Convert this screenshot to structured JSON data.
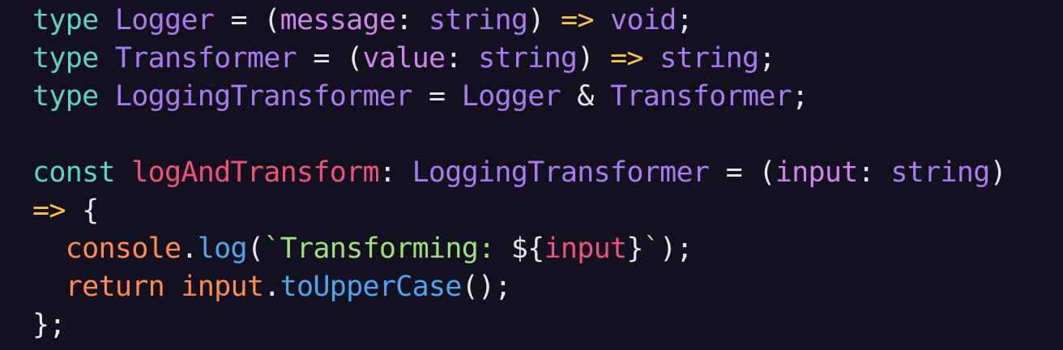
{
  "colors": {
    "background": "#13111f",
    "keyword": "#5fd2c8",
    "type": "#a87cf0",
    "param": "#cf86e8",
    "punctuation": "#e6e6ee",
    "arrow": "#ffc24b",
    "variable": "#f0527a",
    "object": "#ff8a52",
    "method": "#4ea5f0",
    "string": "#9ee07a"
  },
  "code": {
    "lines": [
      [
        {
          "text": "type",
          "kind": "keyword"
        },
        {
          "text": " ",
          "kind": "punctuation"
        },
        {
          "text": "Logger",
          "kind": "type"
        },
        {
          "text": " = (",
          "kind": "punctuation"
        },
        {
          "text": "message",
          "kind": "param"
        },
        {
          "text": ": ",
          "kind": "punctuation"
        },
        {
          "text": "string",
          "kind": "type"
        },
        {
          "text": ") ",
          "kind": "punctuation"
        },
        {
          "text": "=>",
          "kind": "arrow"
        },
        {
          "text": " ",
          "kind": "punctuation"
        },
        {
          "text": "void",
          "kind": "type"
        },
        {
          "text": ";",
          "kind": "punctuation"
        }
      ],
      [
        {
          "text": "type",
          "kind": "keyword"
        },
        {
          "text": " ",
          "kind": "punctuation"
        },
        {
          "text": "Transformer",
          "kind": "type"
        },
        {
          "text": " = (",
          "kind": "punctuation"
        },
        {
          "text": "value",
          "kind": "param"
        },
        {
          "text": ": ",
          "kind": "punctuation"
        },
        {
          "text": "string",
          "kind": "type"
        },
        {
          "text": ") ",
          "kind": "punctuation"
        },
        {
          "text": "=>",
          "kind": "arrow"
        },
        {
          "text": " ",
          "kind": "punctuation"
        },
        {
          "text": "string",
          "kind": "type"
        },
        {
          "text": ";",
          "kind": "punctuation"
        }
      ],
      [
        {
          "text": "type",
          "kind": "keyword"
        },
        {
          "text": " ",
          "kind": "punctuation"
        },
        {
          "text": "LoggingTransformer",
          "kind": "type"
        },
        {
          "text": " = ",
          "kind": "punctuation"
        },
        {
          "text": "Logger",
          "kind": "type"
        },
        {
          "text": " & ",
          "kind": "punctuation"
        },
        {
          "text": "Transformer",
          "kind": "type"
        },
        {
          "text": ";",
          "kind": "punctuation"
        }
      ],
      [],
      [
        {
          "text": "const",
          "kind": "keyword"
        },
        {
          "text": " ",
          "kind": "punctuation"
        },
        {
          "text": "logAndTransform",
          "kind": "variable"
        },
        {
          "text": ": ",
          "kind": "punctuation"
        },
        {
          "text": "LoggingTransformer",
          "kind": "type"
        },
        {
          "text": " = (",
          "kind": "punctuation"
        },
        {
          "text": "input",
          "kind": "param"
        },
        {
          "text": ": ",
          "kind": "punctuation"
        },
        {
          "text": "string",
          "kind": "type"
        },
        {
          "text": ")",
          "kind": "punctuation"
        }
      ],
      [
        {
          "text": "=>",
          "kind": "arrow"
        },
        {
          "text": " {",
          "kind": "punctuation"
        }
      ],
      [
        {
          "text": "  ",
          "kind": "punctuation"
        },
        {
          "text": "console",
          "kind": "object"
        },
        {
          "text": ".",
          "kind": "punctuation"
        },
        {
          "text": "log",
          "kind": "method"
        },
        {
          "text": "(",
          "kind": "punctuation"
        },
        {
          "text": "`Transforming: ",
          "kind": "string"
        },
        {
          "text": "${",
          "kind": "punctuation"
        },
        {
          "text": "input",
          "kind": "variable"
        },
        {
          "text": "}",
          "kind": "punctuation"
        },
        {
          "text": "`",
          "kind": "string"
        },
        {
          "text": ");",
          "kind": "punctuation"
        }
      ],
      [
        {
          "text": "  ",
          "kind": "punctuation"
        },
        {
          "text": "return",
          "kind": "object"
        },
        {
          "text": " ",
          "kind": "punctuation"
        },
        {
          "text": "input",
          "kind": "object"
        },
        {
          "text": ".",
          "kind": "punctuation"
        },
        {
          "text": "toUpperCase",
          "kind": "method"
        },
        {
          "text": "();",
          "kind": "punctuation"
        }
      ],
      [
        {
          "text": "};",
          "kind": "punctuation"
        }
      ]
    ]
  }
}
